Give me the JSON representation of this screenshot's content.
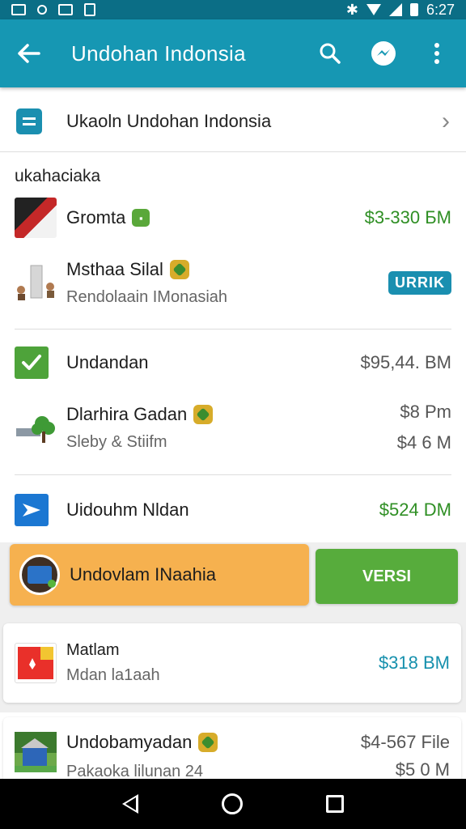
{
  "status_bar": {
    "time": "6:27"
  },
  "app_bar": {
    "title": "Undohan Indonsia"
  },
  "top_card": {
    "label": "Ukaoln Undohan Indonsia"
  },
  "section_title": "ukahaciaka",
  "rows": [
    {
      "name": "Gromta",
      "amount": "$3-330 БМ"
    },
    {
      "name": "Msthaa Silal",
      "subtitle": "Rendolaain IMonasiah",
      "pill": "URRIK"
    },
    {
      "name": "Undandan",
      "amount": "$95,44. BM"
    },
    {
      "name": "Dlarhira Gadan",
      "subtitle": "Sleby & Stiifm",
      "amount": "$8 Pm",
      "amount2": "$4 6 M"
    },
    {
      "name": "Uidouhm Nldan",
      "amount": "$524 DM"
    }
  ],
  "promo": {
    "label": "Undovlam INaahia",
    "button": "VERSI"
  },
  "card_row": {
    "name": "Matlam",
    "subtitle": "Mdan la1aah",
    "amount": "$318 BM"
  },
  "bottom_row": {
    "name": "Undobamyadan",
    "subtitle": "Pakaoka lilunan 24",
    "amount": "$4-567 File",
    "amount2": "$5 0 M"
  },
  "colors": {
    "app_bar": "#1697b3",
    "status_bar": "#0b6e86",
    "green_amount": "#2f8f24",
    "teal_amount": "#1690ad",
    "promo_orange": "#f6b14f",
    "versi_green": "#57ac3c"
  }
}
